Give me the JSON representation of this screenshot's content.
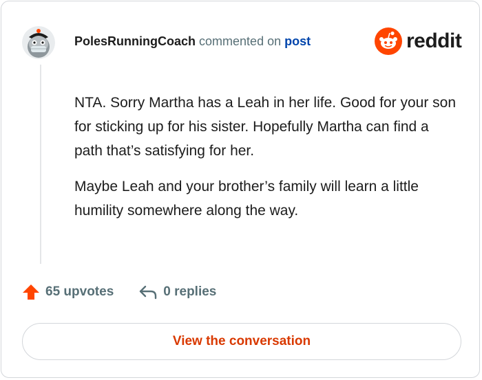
{
  "comment": {
    "author": "PolesRunningCoach",
    "action_text": "commented on",
    "link_text": "post",
    "paragraphs": [
      "NTA. Sorry Martha has a Leah in her life. Good for your son for sticking up for his sister. Hopefully Martha can find a path that’s satisfying for her.",
      "Maybe Leah and your brother’s family will learn a little humility somewhere along the way."
    ]
  },
  "brand": {
    "wordmark": "reddit",
    "icon": "reddit-snoo-icon",
    "accent": "#ff4500"
  },
  "actions": {
    "upvotes": "65 upvotes",
    "upvote_icon": "upvote-arrow-icon",
    "upvote_color": "#ff4500",
    "replies": "0 replies",
    "reply_icon": "reply-arrow-icon"
  },
  "cta": {
    "label": "View the conversation",
    "color": "#d93900"
  }
}
